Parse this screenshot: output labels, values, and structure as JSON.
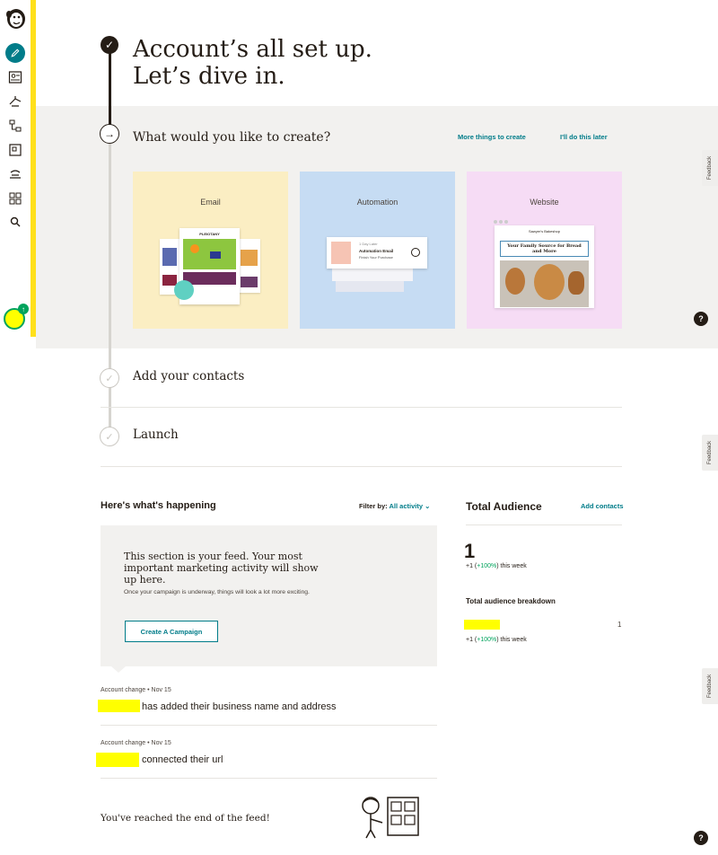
{
  "nav": {
    "items": [
      {
        "name": "create-icon"
      },
      {
        "name": "audience-icon"
      },
      {
        "name": "campaigns-icon"
      },
      {
        "name": "automations-icon"
      },
      {
        "name": "website-icon"
      },
      {
        "name": "integrations-icon"
      },
      {
        "name": "apps-icon"
      },
      {
        "name": "search-icon"
      }
    ],
    "accent": "#ffe01b"
  },
  "hero": {
    "title_line1": "Account’s all set up.",
    "title_line2": "Let’s dive in."
  },
  "create": {
    "question": "What would you like to create?",
    "more_link": "More things to create",
    "later_link": "I'll do this later",
    "cards": [
      {
        "label": "Email",
        "color": "#fbeec3"
      },
      {
        "label": "Automation",
        "color": "#c6dcf3"
      },
      {
        "label": "Website",
        "color": "#f6dcf5"
      }
    ],
    "automation_preview": {
      "delay": "1 Day Later",
      "title": "Automation Email",
      "subtitle": "Finish Your Purchase"
    },
    "email_preview": {
      "brand": "PLEIOTANY"
    },
    "website_preview": {
      "brand": "Sawyer's Bakeshop",
      "headline": "Your Family Source for Bread and More"
    }
  },
  "steps": {
    "contacts": "Add your contacts",
    "launch": "Launch"
  },
  "feed": {
    "title": "Here's what's happening",
    "filter_label": "Filter by:",
    "filter_value": "All activity",
    "empty_heading": "This section is your feed. Your most important marketing activity will show up here.",
    "empty_sub": "Once your campaign is underway, things will look a lot more exciting.",
    "cta": "Create A Campaign",
    "activities": [
      {
        "meta": "Account change  • Nov 15",
        "text": "has added their business name and address"
      },
      {
        "meta": "Account change  • Nov 15",
        "text": "connected their url"
      }
    ],
    "end": "You've reached the end of the feed!"
  },
  "audience": {
    "title": "Total Audience",
    "add_link": "Add contacts",
    "count": "1",
    "week_prefix": "+1 (",
    "week_pct": "+100%",
    "week_suffix": ") this week",
    "breakdown_title": "Total audience breakdown",
    "breakdown_count": "1"
  },
  "misc": {
    "feedback": "Feedback",
    "help": "?"
  }
}
